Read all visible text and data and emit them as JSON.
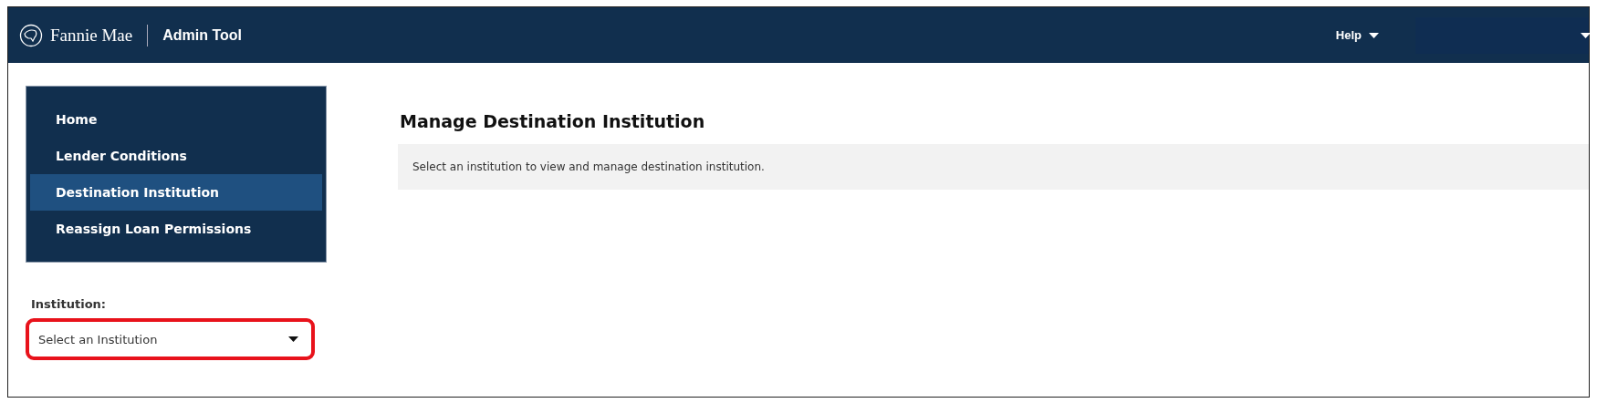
{
  "header": {
    "brand": "Fannie Mae",
    "app_title": "Admin Tool",
    "menus": [
      {
        "label": "Help"
      }
    ]
  },
  "sidebar": {
    "items": [
      {
        "label": "Home",
        "selected": false
      },
      {
        "label": "Lender Conditions",
        "selected": false
      },
      {
        "label": "Destination Institution",
        "selected": true
      },
      {
        "label": "Reassign Loan Permissions",
        "selected": false
      }
    ]
  },
  "institution": {
    "label": "Institution:",
    "placeholder": "Select an Institution",
    "highlighted": true
  },
  "main": {
    "title": "Manage Destination Institution",
    "message": "Select an institution to view and manage destination institution."
  }
}
